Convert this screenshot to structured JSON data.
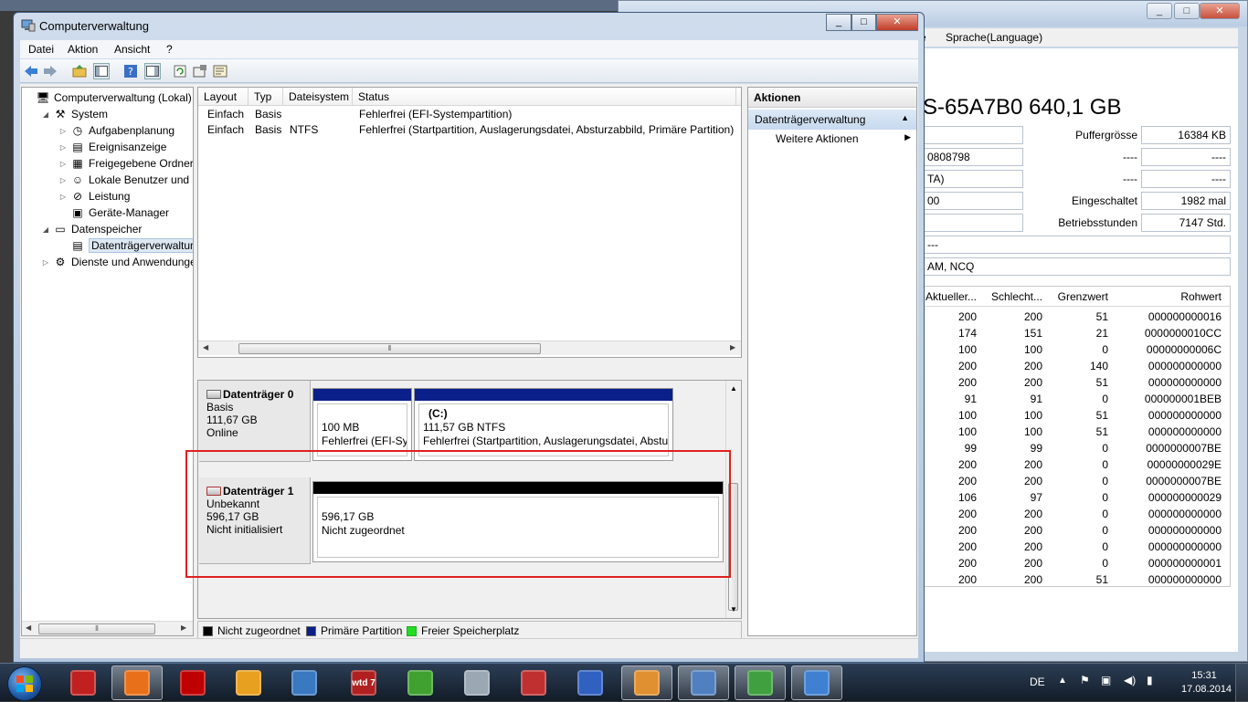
{
  "window": {
    "title": "Computerverwaltung",
    "minimize": "_",
    "maximize": "□",
    "close": "✕"
  },
  "menu": [
    "Datei",
    "Aktion",
    "Ansicht",
    "?"
  ],
  "tree": [
    {
      "label": "Computerverwaltung (Lokal)",
      "icon": "computer-icon",
      "level": 0,
      "expander": ""
    },
    {
      "label": "System",
      "icon": "tools-icon",
      "level": 1,
      "expander": "◢"
    },
    {
      "label": "Aufgabenplanung",
      "icon": "clock-icon",
      "level": 2,
      "expander": "▷"
    },
    {
      "label": "Ereignisanzeige",
      "icon": "event-viewer-icon",
      "level": 2,
      "expander": "▷"
    },
    {
      "label": "Freigegebene Ordner",
      "icon": "shared-folder-icon",
      "level": 2,
      "expander": "▷"
    },
    {
      "label": "Lokale Benutzer und Gru",
      "icon": "users-icon",
      "level": 2,
      "expander": "▷"
    },
    {
      "label": "Leistung",
      "icon": "performance-icon",
      "level": 2,
      "expander": "▷"
    },
    {
      "label": "Geräte-Manager",
      "icon": "device-manager-icon",
      "level": 2,
      "expander": ""
    },
    {
      "label": "Datenspeicher",
      "icon": "storage-icon",
      "level": 1,
      "expander": "◢"
    },
    {
      "label": "Datenträgerverwaltung",
      "icon": "disk-management-icon",
      "level": 2,
      "expander": "",
      "selected": true
    },
    {
      "label": "Dienste und Anwendungen",
      "icon": "services-icon",
      "level": 1,
      "expander": "▷"
    }
  ],
  "volume_list": {
    "columns": [
      "Layout",
      "Typ",
      "Dateisystem",
      "Status"
    ],
    "rows": [
      [
        "Einfach",
        "Basis",
        "",
        "Fehlerfrei (EFI-Systempartition)"
      ],
      [
        "Einfach",
        "Basis",
        "NTFS",
        "Fehlerfrei (Startpartition, Auslagerungsdatei, Absturzabbild, Primäre Partition)"
      ]
    ]
  },
  "disks": [
    {
      "name": "Datenträger 0",
      "type": "Basis",
      "size": "111,67 GB",
      "status": "Online",
      "partitions": [
        {
          "line1": "100 MB",
          "line2": "Fehlerfrei (EFI-Syst",
          "label": "",
          "color": "#0a1f8a"
        },
        {
          "label": "(C:)",
          "line1": "111,57 GB NTFS",
          "line2": "Fehlerfrei (Startpartition, Auslagerungsdatei, Absturzabbild",
          "color": "#0a1f8a"
        }
      ]
    },
    {
      "name": "Datenträger 1",
      "type": "Unbekannt",
      "size": "596,17 GB",
      "status": "Nicht initialisiert",
      "partitions": [
        {
          "line1": "596,17 GB",
          "line2": "Nicht zugeordnet",
          "label": "",
          "color": "#000000"
        }
      ]
    }
  ],
  "legend": [
    {
      "label": "Nicht zugeordnet",
      "color": "#000000"
    },
    {
      "label": "Primäre Partition",
      "color": "#0a1f8a"
    },
    {
      "label": "Freier Speicherplatz",
      "color": "#22dd22"
    }
  ],
  "actions": {
    "header": "Aktionen",
    "section": "Datenträgerverwaltung",
    "item": "Weitere Aktionen"
  },
  "background_app": {
    "menu_partial": "e",
    "menu_language": "Sprache(Language)",
    "disk_title": "S-65A7B0 640,1 GB",
    "left_fields": [
      "",
      "0808798",
      "TA)",
      "00",
      "",
      "---",
      "AM, NCQ"
    ],
    "right_info": [
      {
        "label": "Puffergrösse",
        "value": "16384 KB"
      },
      {
        "label": "----",
        "value": "----"
      },
      {
        "label": "----",
        "value": "----"
      },
      {
        "label": "Eingeschaltet",
        "value": "1982 mal"
      },
      {
        "label": "Betriebsstunden",
        "value": "7147 Std."
      }
    ],
    "smart_columns": [
      "Aktueller...",
      "Schlecht...",
      "Grenzwert",
      "Rohwert"
    ],
    "smart_rows": [
      [
        "200",
        "200",
        "51",
        "000000000016"
      ],
      [
        "174",
        "151",
        "21",
        "0000000010CC"
      ],
      [
        "100",
        "100",
        "0",
        "00000000006C"
      ],
      [
        "200",
        "200",
        "140",
        "000000000000"
      ],
      [
        "200",
        "200",
        "51",
        "000000000000"
      ],
      [
        "91",
        "91",
        "0",
        "000000001BEB"
      ],
      [
        "100",
        "100",
        "51",
        "000000000000"
      ],
      [
        "100",
        "100",
        "51",
        "000000000000"
      ],
      [
        "99",
        "99",
        "0",
        "0000000007BE"
      ],
      [
        "200",
        "200",
        "0",
        "00000000029E"
      ],
      [
        "200",
        "200",
        "0",
        "0000000007BE"
      ],
      [
        "106",
        "97",
        "0",
        "000000000029"
      ],
      [
        "200",
        "200",
        "0",
        "000000000000"
      ],
      [
        "200",
        "200",
        "0",
        "000000000000"
      ],
      [
        "200",
        "200",
        "0",
        "000000000000"
      ],
      [
        "200",
        "200",
        "0",
        "000000000001"
      ],
      [
        "200",
        "200",
        "51",
        "000000000000"
      ]
    ]
  },
  "taskbar": {
    "apps": [
      {
        "name": "taskbar-app-1",
        "icon": "tool-icon",
        "color": "#c02020",
        "active": false
      },
      {
        "name": "taskbar-firefox",
        "icon": "firefox-icon",
        "color": "#e8701a",
        "active": true
      },
      {
        "name": "taskbar-filezilla",
        "icon": "filezilla-icon",
        "color": "#bf0000",
        "active": false
      },
      {
        "name": "taskbar-outlook",
        "icon": "outlook-icon",
        "color": "#e8a020",
        "active": false
      },
      {
        "name": "taskbar-virtualbox",
        "icon": "virtualbox-icon",
        "color": "#3a78c0",
        "active": false
      },
      {
        "name": "taskbar-wtd7",
        "icon": "wtd7-icon",
        "color": "#b02020",
        "active": false,
        "text": "wtd 7"
      },
      {
        "name": "taskbar-app-green",
        "icon": "green-app-icon",
        "color": "#40a030",
        "active": false
      },
      {
        "name": "taskbar-drive",
        "icon": "drive-icon",
        "color": "#9aa8b4",
        "active": false
      },
      {
        "name": "taskbar-app-gear",
        "icon": "gear-icon",
        "color": "#c03030",
        "active": false
      },
      {
        "name": "taskbar-app-blocks",
        "icon": "blocks-icon",
        "color": "#3060c0",
        "active": false
      },
      {
        "name": "taskbar-media",
        "icon": "media-icon",
        "color": "#e09030",
        "active": true
      },
      {
        "name": "taskbar-computer-management",
        "icon": "computer-management-icon",
        "color": "#5080c0",
        "active": true
      },
      {
        "name": "taskbar-app-search",
        "icon": "search-icon",
        "color": "#40a040",
        "active": true
      },
      {
        "name": "taskbar-network",
        "icon": "network-icon",
        "color": "#4080d0",
        "active": true
      }
    ],
    "lang": "DE",
    "time": "15:31",
    "date": "17.08.2014"
  }
}
